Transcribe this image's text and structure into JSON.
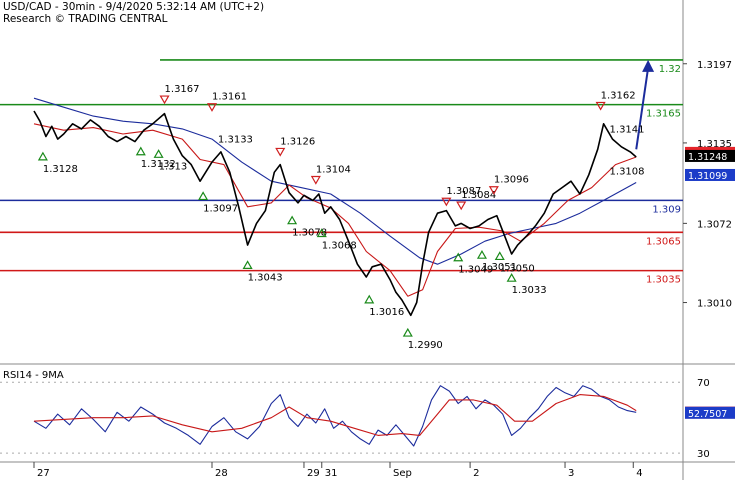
{
  "header": {
    "title": "USD/CAD - 30min - 9/4/2020 5:32:14 AM (UTC+2)",
    "research": "Research © TRADING CENTRAL"
  },
  "chart_data": {
    "type": "line",
    "price_axis": {
      "ylim": [
        1.2965,
        1.3225
      ],
      "ticks": [
        "1.3197",
        "1.3135",
        "1.3072",
        "1.3010"
      ]
    },
    "levels": [
      {
        "label": "1.32",
        "value": 1.32,
        "color": "#1a8a1a"
      },
      {
        "label": "1.3165",
        "value": 1.3165,
        "color": "#1a8a1a"
      },
      {
        "label": "1.309",
        "value": 1.309,
        "color": "#1c2c9c"
      },
      {
        "label": "1.3065",
        "value": 1.3065,
        "color": "#d01818"
      },
      {
        "label": "1.3035",
        "value": 1.3035,
        "color": "#d01818"
      }
    ],
    "price_labels": [
      {
        "text": "1.31272",
        "value": 1.31272,
        "bg": "#e5242a"
      },
      {
        "text": "1.31248",
        "value": 1.31248,
        "bg": "#000000"
      },
      {
        "text": "1.31099",
        "value": 1.31099,
        "bg": "#1c3cc8"
      }
    ],
    "highs": [
      {
        "x": 0.2,
        "value": 1.3167,
        "label": "1.3167"
      },
      {
        "x": 1.0,
        "value": 1.3161,
        "label": "1.3161"
      },
      {
        "x": 2.15,
        "value": 1.3126,
        "label": "1.3126"
      },
      {
        "x": 2.75,
        "value": 1.3104,
        "label": "1.3104"
      },
      {
        "x": 4.95,
        "value": 1.3087,
        "label": "1.3087"
      },
      {
        "x": 5.2,
        "value": 1.3084,
        "label": "1.3084"
      },
      {
        "x": 5.75,
        "value": 1.3096,
        "label": "1.3096"
      },
      {
        "x": 7.55,
        "value": 1.3162,
        "label": "1.3162"
      }
    ],
    "lows": [
      {
        "x": -1.85,
        "value": 1.3128,
        "label": "1.3128"
      },
      {
        "x": -0.2,
        "value": 1.3132,
        "label": "1.3132"
      },
      {
        "x": 0.1,
        "value": 1.313,
        "label": "1.313"
      },
      {
        "x": 0.85,
        "value": 1.3097,
        "label": "1.3097"
      },
      {
        "x": 1.6,
        "value": 1.3043,
        "label": "1.3043"
      },
      {
        "x": 2.35,
        "value": 1.3078,
        "label": "1.3078"
      },
      {
        "x": 2.85,
        "value": 1.3068,
        "label": "1.3068"
      },
      {
        "x": 3.65,
        "value": 1.3016,
        "label": "1.3016"
      },
      {
        "x": 4.3,
        "value": 1.299,
        "label": "1.2990"
      },
      {
        "x": 5.15,
        "value": 1.3049,
        "label": "1.3049"
      },
      {
        "x": 5.55,
        "value": 1.3051,
        "label": "1.3051"
      },
      {
        "x": 5.85,
        "value": 1.305,
        "label": "1.3050"
      },
      {
        "x": 6.05,
        "value": 1.3033,
        "label": "1.3033"
      }
    ],
    "level_notes": [
      {
        "x": 1.1,
        "value": 1.3133,
        "label": "1.3133"
      },
      {
        "x": 7.7,
        "value": 1.3141,
        "label": "1.3141"
      },
      {
        "x": 7.7,
        "value": 1.3108,
        "label": "1.3108"
      }
    ],
    "price_path": [
      [
        -2.0,
        1.316
      ],
      [
        -1.9,
        1.3152
      ],
      [
        -1.8,
        1.314
      ],
      [
        -1.7,
        1.3148
      ],
      [
        -1.6,
        1.3138
      ],
      [
        -1.5,
        1.3142
      ],
      [
        -1.35,
        1.315
      ],
      [
        -1.2,
        1.3146
      ],
      [
        -1.05,
        1.3153
      ],
      [
        -0.9,
        1.3148
      ],
      [
        -0.75,
        1.314
      ],
      [
        -0.6,
        1.3136
      ],
      [
        -0.45,
        1.314
      ],
      [
        -0.3,
        1.3136
      ],
      [
        -0.15,
        1.3145
      ],
      [
        0.0,
        1.315
      ],
      [
        0.2,
        1.3158
      ],
      [
        0.35,
        1.3138
      ],
      [
        0.5,
        1.3125
      ],
      [
        0.65,
        1.3118
      ],
      [
        0.8,
        1.3105
      ],
      [
        1.0,
        1.312
      ],
      [
        1.15,
        1.3128
      ],
      [
        1.3,
        1.3112
      ],
      [
        1.45,
        1.3085
      ],
      [
        1.6,
        1.3055
      ],
      [
        1.75,
        1.3072
      ],
      [
        1.9,
        1.3082
      ],
      [
        2.05,
        1.3112
      ],
      [
        2.15,
        1.3118
      ],
      [
        2.3,
        1.3096
      ],
      [
        2.45,
        1.3088
      ],
      [
        2.55,
        1.3094
      ],
      [
        2.7,
        1.309
      ],
      [
        2.8,
        1.3095
      ],
      [
        2.9,
        1.308
      ],
      [
        3.0,
        1.3085
      ],
      [
        3.15,
        1.3075
      ],
      [
        3.3,
        1.3058
      ],
      [
        3.45,
        1.304
      ],
      [
        3.6,
        1.303
      ],
      [
        3.7,
        1.3038
      ],
      [
        3.85,
        1.304
      ],
      [
        4.0,
        1.3028
      ],
      [
        4.1,
        1.3018
      ],
      [
        4.2,
        1.3012
      ],
      [
        4.35,
        1.3
      ],
      [
        4.45,
        1.301
      ],
      [
        4.55,
        1.304
      ],
      [
        4.65,
        1.3065
      ],
      [
        4.8,
        1.308
      ],
      [
        4.95,
        1.3082
      ],
      [
        5.1,
        1.307
      ],
      [
        5.2,
        1.3072
      ],
      [
        5.35,
        1.3068
      ],
      [
        5.5,
        1.307
      ],
      [
        5.65,
        1.3075
      ],
      [
        5.8,
        1.3078
      ],
      [
        5.95,
        1.306
      ],
      [
        6.05,
        1.3048
      ],
      [
        6.15,
        1.3055
      ],
      [
        6.3,
        1.3062
      ],
      [
        6.45,
        1.307
      ],
      [
        6.6,
        1.308
      ],
      [
        6.75,
        1.3095
      ],
      [
        6.9,
        1.31
      ],
      [
        7.05,
        1.3105
      ],
      [
        7.2,
        1.3095
      ],
      [
        7.35,
        1.311
      ],
      [
        7.5,
        1.313
      ],
      [
        7.6,
        1.315
      ],
      [
        7.75,
        1.3138
      ],
      [
        7.9,
        1.3132
      ],
      [
        8.05,
        1.3128
      ],
      [
        8.15,
        1.3124
      ]
    ],
    "ma_red": [
      [
        -2.0,
        1.315
      ],
      [
        -1.5,
        1.3145
      ],
      [
        -1.0,
        1.3147
      ],
      [
        -0.5,
        1.3142
      ],
      [
        0.0,
        1.3145
      ],
      [
        0.5,
        1.3138
      ],
      [
        0.8,
        1.3122
      ],
      [
        1.2,
        1.3118
      ],
      [
        1.6,
        1.3085
      ],
      [
        2.0,
        1.3088
      ],
      [
        2.3,
        1.3102
      ],
      [
        2.6,
        1.3092
      ],
      [
        3.0,
        1.3084
      ],
      [
        3.3,
        1.3072
      ],
      [
        3.6,
        1.305
      ],
      [
        4.0,
        1.3035
      ],
      [
        4.3,
        1.3015
      ],
      [
        4.55,
        1.302
      ],
      [
        4.8,
        1.305
      ],
      [
        5.1,
        1.3068
      ],
      [
        5.5,
        1.3069
      ],
      [
        5.9,
        1.3066
      ],
      [
        6.2,
        1.3058
      ],
      [
        6.6,
        1.3072
      ],
      [
        7.0,
        1.309
      ],
      [
        7.4,
        1.31
      ],
      [
        7.8,
        1.3118
      ],
      [
        8.15,
        1.3124
      ]
    ],
    "ma_blue": [
      [
        -2.0,
        1.317
      ],
      [
        -1.5,
        1.3163
      ],
      [
        -1.0,
        1.3156
      ],
      [
        -0.5,
        1.3152
      ],
      [
        0.0,
        1.315
      ],
      [
        0.5,
        1.3146
      ],
      [
        1.0,
        1.3138
      ],
      [
        1.5,
        1.312
      ],
      [
        2.0,
        1.3105
      ],
      [
        2.5,
        1.31
      ],
      [
        3.0,
        1.3095
      ],
      [
        3.5,
        1.308
      ],
      [
        4.0,
        1.3062
      ],
      [
        4.5,
        1.3045
      ],
      [
        4.8,
        1.304
      ],
      [
        5.2,
        1.3048
      ],
      [
        5.6,
        1.3058
      ],
      [
        6.0,
        1.3064
      ],
      [
        6.4,
        1.3068
      ],
      [
        6.8,
        1.3072
      ],
      [
        7.2,
        1.308
      ],
      [
        7.6,
        1.309
      ],
      [
        8.15,
        1.3104
      ]
    ],
    "forecast_arrow": {
      "from": [
        8.15,
        1.313
      ],
      "to": [
        8.35,
        1.32
      ]
    },
    "x_axis": {
      "ticks": [
        {
          "label": "27",
          "x": -2.0
        },
        {
          "label": "28",
          "x": 1.0
        },
        {
          "label": "29",
          "x": 2.55
        },
        {
          "label": "31",
          "x": 2.85
        },
        {
          "label": "Sep",
          "x": 4.0
        },
        {
          "label": "2",
          "x": 5.35
        },
        {
          "label": "3",
          "x": 6.95
        },
        {
          "label": "4",
          "x": 8.1
        }
      ]
    },
    "rsi": {
      "title": "RSI14 - 9MA",
      "ylim": [
        25,
        78
      ],
      "ticks": [
        "70",
        "30"
      ],
      "labels": [
        {
          "text": "52.8505",
          "value": 52.8505,
          "bg": "#e5242a"
        },
        {
          "text": "52.7507",
          "value": 52.7507,
          "bg": "#1c3cc8"
        }
      ],
      "rsi_path": [
        [
          -2.0,
          48
        ],
        [
          -1.8,
          44
        ],
        [
          -1.6,
          52
        ],
        [
          -1.4,
          46
        ],
        [
          -1.2,
          55
        ],
        [
          -1.0,
          49
        ],
        [
          -0.8,
          42
        ],
        [
          -0.6,
          53
        ],
        [
          -0.4,
          48
        ],
        [
          -0.2,
          56
        ],
        [
          0.0,
          52
        ],
        [
          0.2,
          47
        ],
        [
          0.4,
          44
        ],
        [
          0.6,
          40
        ],
        [
          0.8,
          35
        ],
        [
          1.0,
          45
        ],
        [
          1.2,
          50
        ],
        [
          1.4,
          42
        ],
        [
          1.6,
          38
        ],
        [
          1.8,
          45
        ],
        [
          2.0,
          58
        ],
        [
          2.15,
          63
        ],
        [
          2.3,
          50
        ],
        [
          2.45,
          45
        ],
        [
          2.6,
          52
        ],
        [
          2.75,
          47
        ],
        [
          2.9,
          55
        ],
        [
          3.05,
          44
        ],
        [
          3.2,
          48
        ],
        [
          3.35,
          42
        ],
        [
          3.5,
          38
        ],
        [
          3.65,
          35
        ],
        [
          3.8,
          43
        ],
        [
          3.95,
          40
        ],
        [
          4.1,
          46
        ],
        [
          4.25,
          40
        ],
        [
          4.4,
          34
        ],
        [
          4.55,
          45
        ],
        [
          4.7,
          60
        ],
        [
          4.85,
          68
        ],
        [
          5.0,
          65
        ],
        [
          5.15,
          58
        ],
        [
          5.3,
          62
        ],
        [
          5.45,
          55
        ],
        [
          5.6,
          60
        ],
        [
          5.75,
          57
        ],
        [
          5.9,
          52
        ],
        [
          6.05,
          40
        ],
        [
          6.2,
          44
        ],
        [
          6.35,
          50
        ],
        [
          6.5,
          55
        ],
        [
          6.65,
          62
        ],
        [
          6.8,
          67
        ],
        [
          6.95,
          64
        ],
        [
          7.1,
          62
        ],
        [
          7.25,
          68
        ],
        [
          7.4,
          66
        ],
        [
          7.55,
          62
        ],
        [
          7.7,
          60
        ],
        [
          7.85,
          56
        ],
        [
          8.0,
          54
        ],
        [
          8.15,
          53
        ]
      ],
      "ma_path": [
        [
          -2.0,
          48
        ],
        [
          -1.5,
          49
        ],
        [
          -1.0,
          50
        ],
        [
          -0.5,
          50
        ],
        [
          0.0,
          51
        ],
        [
          0.5,
          46
        ],
        [
          1.0,
          42
        ],
        [
          1.5,
          44
        ],
        [
          2.0,
          50
        ],
        [
          2.3,
          56
        ],
        [
          2.6,
          50
        ],
        [
          3.0,
          48
        ],
        [
          3.4,
          44
        ],
        [
          3.8,
          40
        ],
        [
          4.2,
          41
        ],
        [
          4.5,
          40
        ],
        [
          4.8,
          52
        ],
        [
          5.0,
          60
        ],
        [
          5.4,
          60
        ],
        [
          5.8,
          57
        ],
        [
          6.1,
          48
        ],
        [
          6.4,
          48
        ],
        [
          6.8,
          58
        ],
        [
          7.2,
          63
        ],
        [
          7.6,
          62
        ],
        [
          8.0,
          57
        ],
        [
          8.15,
          54
        ]
      ]
    }
  },
  "colors": {
    "price": "#000000",
    "ma_red": "#c81818",
    "ma_blue": "#1c2c9c",
    "rsi_line": "#1c2c9c",
    "rsi_ma": "#c81818",
    "arrow": "#1c2c9c",
    "high_marker": "#d02020",
    "low_marker": "#1a8a1a"
  }
}
